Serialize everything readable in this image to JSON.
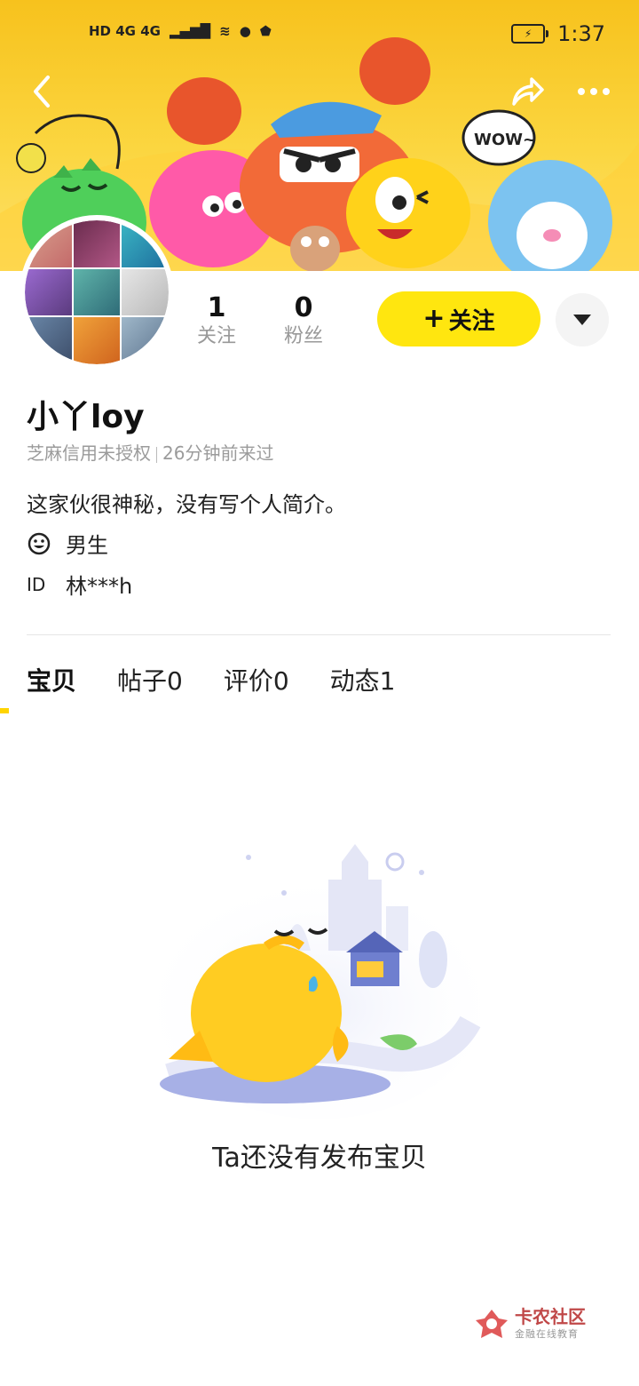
{
  "status_bar": {
    "network": "HD 4G 4G",
    "time": "1:37"
  },
  "header": {
    "banner_speech": "WOW~"
  },
  "profile": {
    "following_count": "1",
    "following_label": "关注",
    "followers_count": "0",
    "followers_label": "粉丝",
    "follow_button": "关注",
    "name": "小丫loy",
    "credit_status": "芝麻信用未授权",
    "last_seen": "26分钟前来过",
    "bio": "这家伙很神秘，没有写个人简介。",
    "gender": "男生",
    "id_label": "ID",
    "id_value": "林***h"
  },
  "tabs": [
    {
      "label": "宝贝"
    },
    {
      "label": "帖子0"
    },
    {
      "label": "评价0"
    },
    {
      "label": "动态1"
    }
  ],
  "empty_state": {
    "message": "Ta还没有发布宝贝"
  },
  "watermark": {
    "title": "卡农社区",
    "subtitle": "金融在线教育"
  },
  "colors": {
    "accent": "#ffe60f",
    "banner": "#f7c21d"
  }
}
